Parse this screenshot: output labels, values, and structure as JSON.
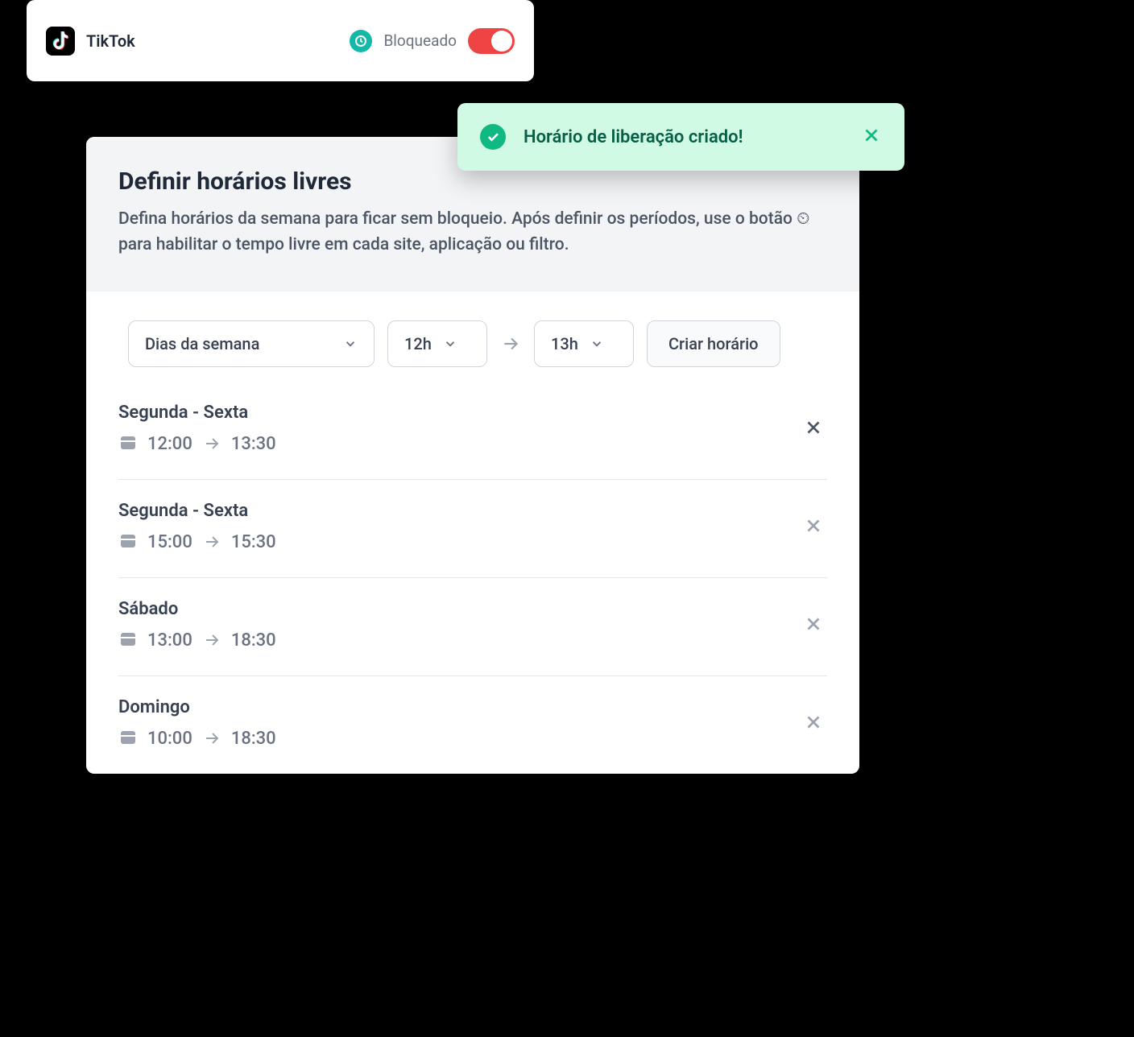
{
  "app_card": {
    "name": "TikTok",
    "status_label": "Bloqueado"
  },
  "toast": {
    "message": "Horário de liberação criado!"
  },
  "panel": {
    "title": "Definir horários livres",
    "description": "Defina horários da semana para ficar sem bloqueio. Após definir os períodos, use o botão ⏲ para habilitar o tempo livre em cada site, aplicação ou filtro."
  },
  "controls": {
    "days_label": "Dias da semana",
    "from_hour": "12h",
    "to_hour": "13h",
    "create_button": "Criar horário"
  },
  "schedules": [
    {
      "days": "Segunda - Sexta",
      "from": "12:00",
      "to": "13:30",
      "dark_delete": true
    },
    {
      "days": "Segunda - Sexta",
      "from": "15:00",
      "to": "15:30",
      "dark_delete": false
    },
    {
      "days": "Sábado",
      "from": "13:00",
      "to": "18:30",
      "dark_delete": false
    },
    {
      "days": "Domingo",
      "from": "10:00",
      "to": "18:30",
      "dark_delete": false
    }
  ]
}
